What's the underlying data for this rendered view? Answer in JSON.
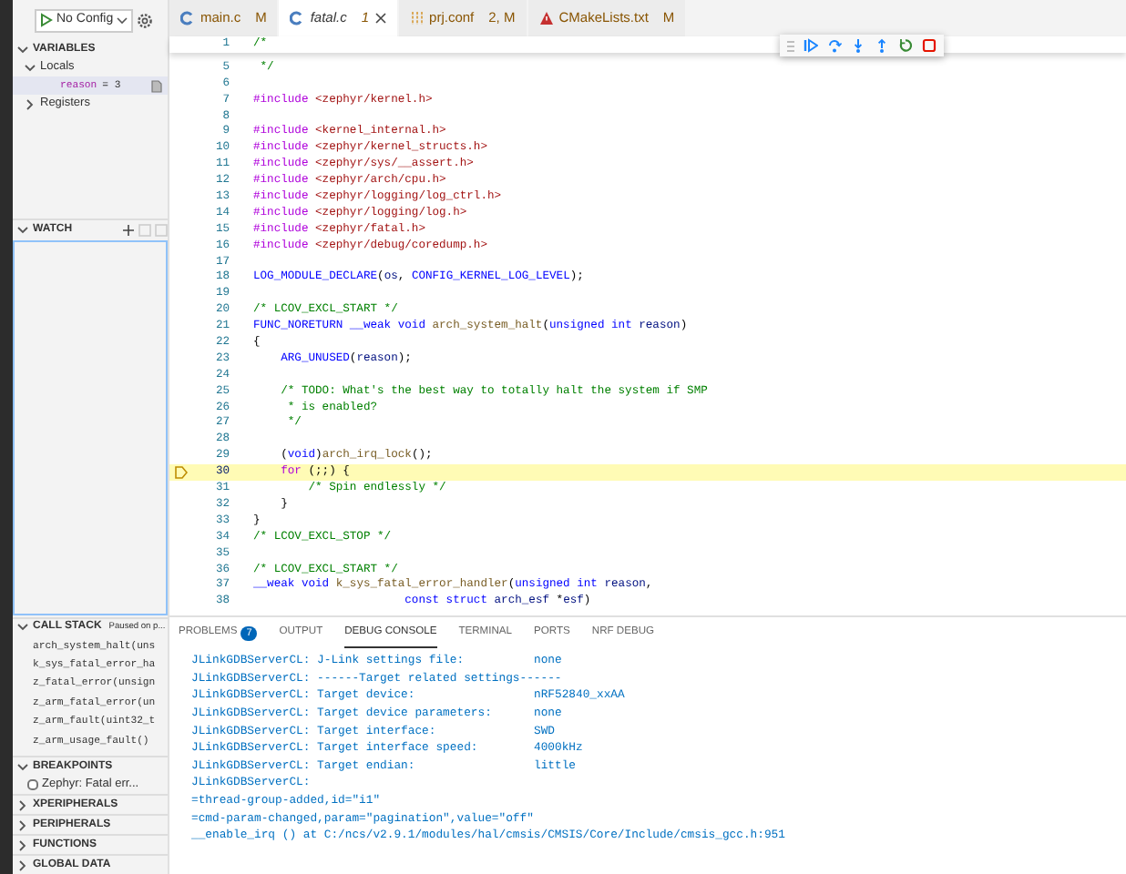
{
  "sidebar": {
    "run_config": "No Config",
    "sections": [
      {
        "kind": "variables",
        "title": "VARIABLES",
        "expanded": true,
        "scopes": [
          {
            "label": "Locals",
            "expanded": true,
            "children": [
              {
                "name": "reason",
                "value": "= 3"
              }
            ]
          },
          {
            "label": "Registers",
            "expanded": false
          }
        ]
      },
      {
        "kind": "watch",
        "title": "WATCH",
        "expanded": true
      },
      {
        "kind": "call_stack",
        "title": "CALL STACK",
        "expanded": true,
        "status": "Paused on p...",
        "frames": [
          "arch_system_halt(uns",
          "k_sys_fatal_error_ha",
          "z_fatal_error(unsign",
          "z_arm_fatal_error(un",
          "z_arm_fault(uint32_t",
          "z_arm_usage_fault()"
        ]
      },
      {
        "kind": "breakpoints",
        "title": "BREAKPOINTS",
        "expanded": true,
        "items": [
          {
            "label": "Zephyr: Fatal err...",
            "checked": false
          }
        ]
      },
      {
        "kind": "plain",
        "title": "XPERIPHERALS",
        "expanded": false
      },
      {
        "kind": "plain",
        "title": "PERIPHERALS",
        "expanded": false
      },
      {
        "kind": "plain",
        "title": "FUNCTIONS",
        "expanded": false
      },
      {
        "kind": "plain",
        "title": "GLOBAL DATA",
        "expanded": false
      }
    ]
  },
  "editor": {
    "tabs": [
      {
        "kind": "c",
        "label": "main.c",
        "status": "M",
        "selected": false
      },
      {
        "kind": "c",
        "label": "fatal.c",
        "status": "1",
        "selected": true
      },
      {
        "kind": "config",
        "label": "prj.conf",
        "status": "2, M",
        "selected": false
      },
      {
        "kind": "cmake",
        "label": "CMakeLists.txt",
        "status": "M",
        "selected": false
      }
    ],
    "sticky": {
      "number": "1",
      "parts": [
        {
          "kind": "cm",
          "text": "/*"
        }
      ]
    },
    "lines": [
      {
        "number": "5",
        "current": false,
        "parts": [
          {
            "kind": "cm",
            "text": " */"
          }
        ]
      },
      {
        "number": "6",
        "current": false
      },
      {
        "number": "7",
        "current": false,
        "parts": [
          {
            "kind": "pp",
            "text": "#include "
          },
          {
            "kind": "str",
            "text": "<zephyr/kernel.h>"
          }
        ]
      },
      {
        "number": "8",
        "current": false
      },
      {
        "number": "9",
        "current": false,
        "parts": [
          {
            "kind": "pp",
            "text": "#include "
          },
          {
            "kind": "str",
            "text": "<kernel_internal.h>"
          }
        ]
      },
      {
        "number": "10",
        "current": false,
        "parts": [
          {
            "kind": "pp",
            "text": "#include "
          },
          {
            "kind": "str",
            "text": "<zephyr/kernel_structs.h>"
          }
        ]
      },
      {
        "number": "11",
        "current": false,
        "parts": [
          {
            "kind": "pp",
            "text": "#include "
          },
          {
            "kind": "str",
            "text": "<zephyr/sys/__assert.h>"
          }
        ]
      },
      {
        "number": "12",
        "current": false,
        "parts": [
          {
            "kind": "pp",
            "text": "#include "
          },
          {
            "kind": "str",
            "text": "<zephyr/arch/cpu.h>"
          }
        ]
      },
      {
        "number": "13",
        "current": false,
        "parts": [
          {
            "kind": "pp",
            "text": "#include "
          },
          {
            "kind": "str",
            "text": "<zephyr/logging/log_ctrl.h>"
          }
        ]
      },
      {
        "number": "14",
        "current": false,
        "parts": [
          {
            "kind": "pp",
            "text": "#include "
          },
          {
            "kind": "str",
            "text": "<zephyr/logging/log.h>"
          }
        ]
      },
      {
        "number": "15",
        "current": false,
        "parts": [
          {
            "kind": "pp",
            "text": "#include "
          },
          {
            "kind": "str",
            "text": "<zephyr/fatal.h>"
          }
        ]
      },
      {
        "number": "16",
        "current": false,
        "parts": [
          {
            "kind": "pp",
            "text": "#include "
          },
          {
            "kind": "str",
            "text": "<zephyr/debug/coredump.h>"
          }
        ]
      },
      {
        "number": "17",
        "current": false
      },
      {
        "number": "18",
        "current": false,
        "parts": [
          {
            "kind": "kw",
            "text": "LOG_MODULE_DECLARE"
          },
          {
            "kind": "plain",
            "text": "("
          },
          {
            "kind": "var",
            "text": "os"
          },
          {
            "kind": "plain",
            "text": ", "
          },
          {
            "kind": "kw",
            "text": "CONFIG_KERNEL_LOG_LEVEL"
          },
          {
            "kind": "plain",
            "text": ");"
          }
        ]
      },
      {
        "number": "19",
        "current": false
      },
      {
        "number": "20",
        "current": false,
        "parts": [
          {
            "kind": "cm",
            "text": "/* LCOV_EXCL_START */"
          }
        ]
      },
      {
        "number": "21",
        "current": false,
        "parts": [
          {
            "kind": "kw",
            "text": "FUNC_NORETURN __weak void "
          },
          {
            "kind": "fn",
            "text": "arch_system_halt"
          },
          {
            "kind": "plain",
            "text": "("
          },
          {
            "kind": "kw",
            "text": "unsigned int "
          },
          {
            "kind": "var",
            "text": "reason"
          },
          {
            "kind": "plain",
            "text": ")"
          }
        ]
      },
      {
        "number": "22",
        "current": false,
        "parts": [
          {
            "kind": "plain",
            "text": "{"
          }
        ]
      },
      {
        "number": "23",
        "current": false,
        "parts": [
          {
            "kind": "kw",
            "text": "    ARG_UNUSED"
          },
          {
            "kind": "plain",
            "text": "("
          },
          {
            "kind": "var",
            "text": "reason"
          },
          {
            "kind": "plain",
            "text": ");"
          }
        ]
      },
      {
        "number": "24",
        "current": false
      },
      {
        "number": "25",
        "current": false,
        "parts": [
          {
            "kind": "cm",
            "text": "    /* TODO: What's the best way to totally halt the system if SMP"
          }
        ]
      },
      {
        "number": "26",
        "current": false,
        "parts": [
          {
            "kind": "cm",
            "text": "     * is enabled?"
          }
        ]
      },
      {
        "number": "27",
        "current": false,
        "parts": [
          {
            "kind": "cm",
            "text": "     */"
          }
        ]
      },
      {
        "number": "28",
        "current": false
      },
      {
        "number": "29",
        "current": false,
        "parts": [
          {
            "kind": "plain",
            "text": "    ("
          },
          {
            "kind": "kw",
            "text": "void"
          },
          {
            "kind": "plain",
            "text": ")"
          },
          {
            "kind": "fn",
            "text": "arch_irq_lock"
          },
          {
            "kind": "plain",
            "text": "();"
          }
        ]
      },
      {
        "number": "30",
        "current": true,
        "parts": [
          {
            "kind": "ctl",
            "text": "    for"
          },
          {
            "kind": "plain",
            "text": " (;;) {"
          }
        ]
      },
      {
        "number": "31",
        "current": false,
        "parts": [
          {
            "kind": "cm",
            "text": "        /* Spin endlessly */"
          }
        ]
      },
      {
        "number": "32",
        "current": false,
        "parts": [
          {
            "kind": "plain",
            "text": "    }"
          }
        ]
      },
      {
        "number": "33",
        "current": false,
        "parts": [
          {
            "kind": "plain",
            "text": "}"
          }
        ]
      },
      {
        "number": "34",
        "current": false,
        "parts": [
          {
            "kind": "cm",
            "text": "/* LCOV_EXCL_STOP */"
          }
        ]
      },
      {
        "number": "35",
        "current": false
      },
      {
        "number": "36",
        "current": false,
        "parts": [
          {
            "kind": "cm",
            "text": "/* LCOV_EXCL_START */"
          }
        ]
      },
      {
        "number": "37",
        "current": false,
        "parts": [
          {
            "kind": "kw",
            "text": "__weak void "
          },
          {
            "kind": "fn",
            "text": "k_sys_fatal_error_handler"
          },
          {
            "kind": "plain",
            "text": "("
          },
          {
            "kind": "kw",
            "text": "unsigned int "
          },
          {
            "kind": "var",
            "text": "reason"
          },
          {
            "kind": "plain",
            "text": ","
          }
        ]
      },
      {
        "number": "38",
        "current": false,
        "parts": [
          {
            "kind": "kw",
            "text": "                      const struct "
          },
          {
            "kind": "var",
            "text": "arch_esf "
          },
          {
            "kind": "plain",
            "text": "*"
          },
          {
            "kind": "var",
            "text": "esf"
          },
          {
            "kind": "plain",
            "text": ")"
          }
        ]
      }
    ]
  },
  "panel": {
    "tabs": [
      {
        "label": "PROBLEMS",
        "badge": "7",
        "selected": false
      },
      {
        "label": "OUTPUT",
        "selected": false
      },
      {
        "label": "DEBUG CONSOLE",
        "selected": true
      },
      {
        "label": "TERMINAL",
        "selected": false
      },
      {
        "label": "PORTS",
        "selected": false
      },
      {
        "label": "NRF DEBUG",
        "selected": false
      }
    ],
    "console": [
      {
        "text": "JLinkGDBServerCL: J-Link settings file:",
        "value": "none"
      },
      {
        "text": "JLinkGDBServerCL: ------Target related settings------"
      },
      {
        "text": "JLinkGDBServerCL: Target device:",
        "value": "nRF52840_xxAA"
      },
      {
        "text": "JLinkGDBServerCL: Target device parameters:",
        "value": "none"
      },
      {
        "text": "JLinkGDBServerCL: Target interface:",
        "value": "SWD"
      },
      {
        "text": "JLinkGDBServerCL: Target interface speed:",
        "value": "4000kHz"
      },
      {
        "text": "JLinkGDBServerCL: Target endian:",
        "value": "little"
      },
      {
        "text": "JLinkGDBServerCL:"
      },
      {
        "text": "=thread-group-added,id=\"i1\""
      },
      {
        "text": "=cmd-param-changed,param=\"pagination\",value=\"off\""
      },
      {
        "text": "__enable_irq () at C:/ncs/v2.9.1/modules/hal/cmsis/CMSIS/Core/Include/cmsis_gcc.h:951"
      }
    ]
  }
}
